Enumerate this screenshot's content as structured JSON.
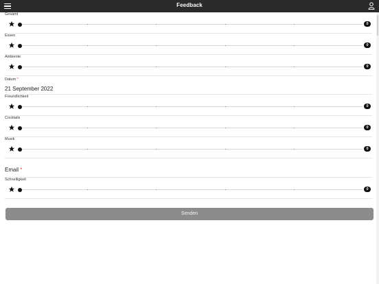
{
  "header": {
    "title": "Feedback"
  },
  "fields": [
    {
      "kind": "rating",
      "label": "Gesamt",
      "value": "0"
    },
    {
      "kind": "rating",
      "label": "Essen",
      "value": "0"
    },
    {
      "kind": "rating",
      "label": "Ambiente",
      "value": "0"
    },
    {
      "kind": "date",
      "label": "Datum",
      "required": "*",
      "value": "21 September 2022"
    },
    {
      "kind": "rating",
      "label": "Freundlichkeit",
      "value": "0"
    },
    {
      "kind": "rating",
      "label": "Cocktails",
      "value": "0"
    },
    {
      "kind": "rating",
      "label": "Musik",
      "value": "0"
    },
    {
      "kind": "email",
      "label": "Email",
      "required": "*"
    },
    {
      "kind": "rating",
      "label": "Schnelligkeit",
      "value": "0"
    }
  ],
  "submit_label": "Senden",
  "colors": {
    "header_bg": "#2a2a2a",
    "button_bg": "#8c8c8c",
    "required": "#e05050"
  },
  "icons": {
    "menu": "hamburger-icon",
    "user": "user-icon",
    "rating": "star-icon"
  }
}
